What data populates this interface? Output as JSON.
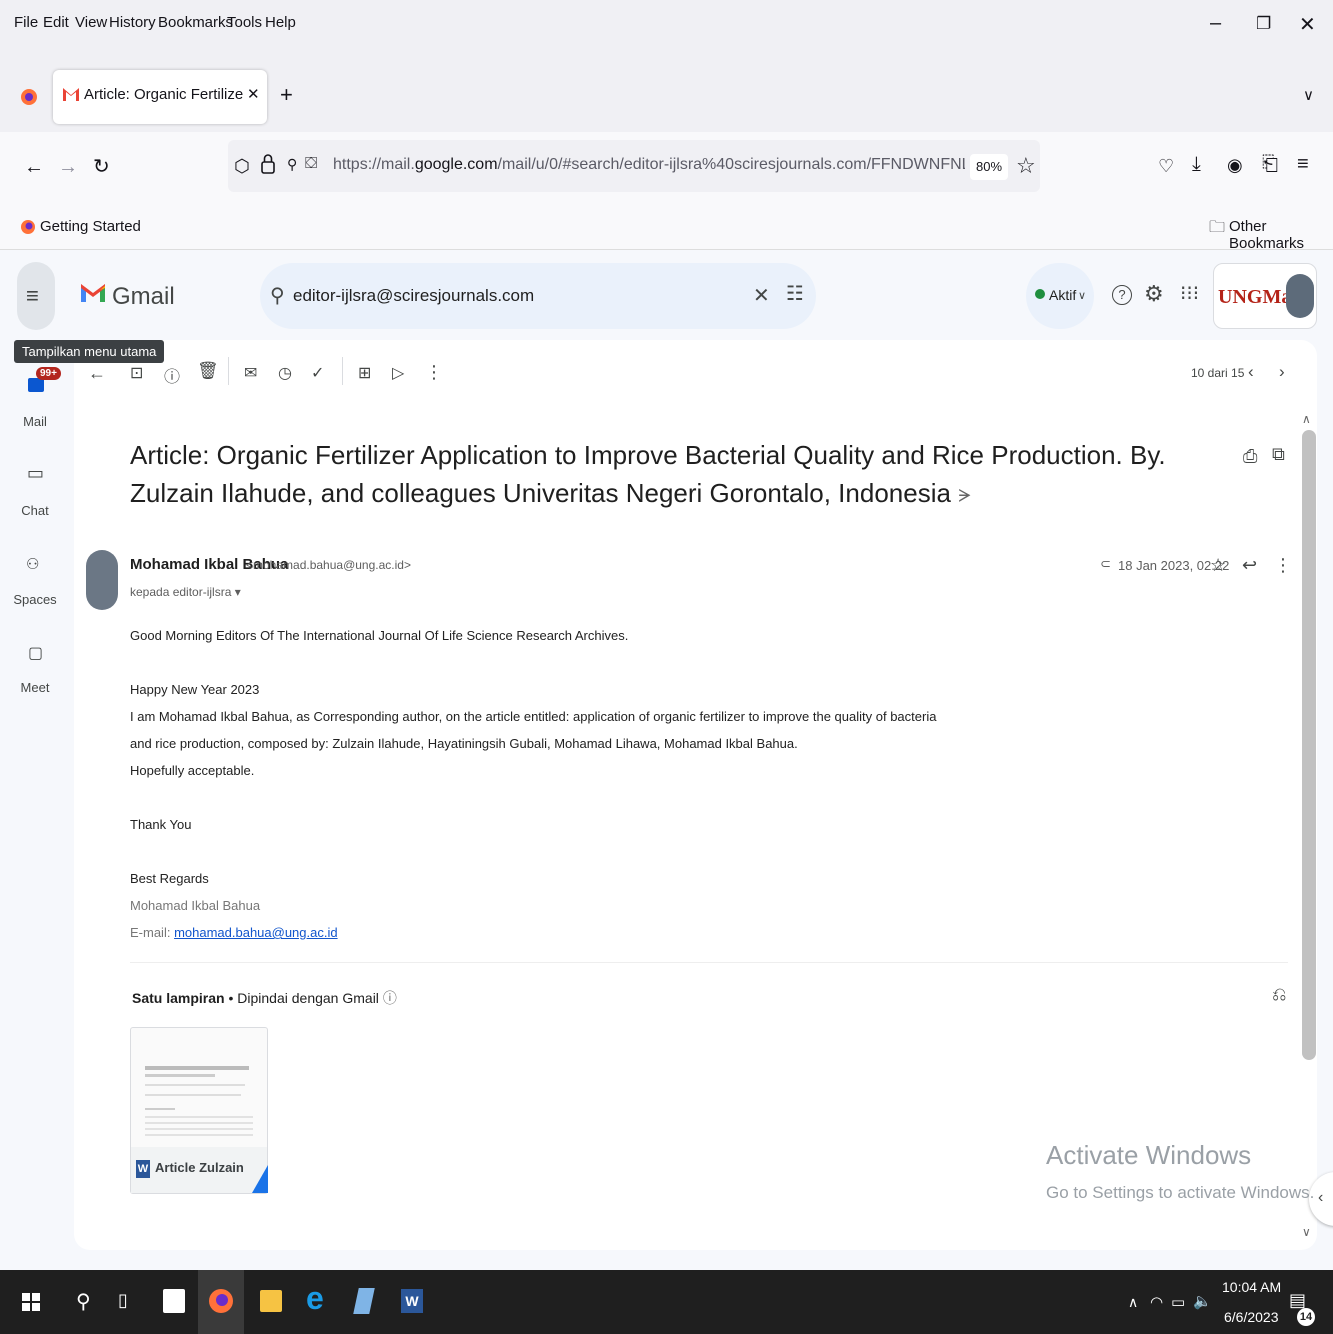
{
  "menubar": {
    "items": [
      "File",
      "Edit",
      "View",
      "History",
      "Bookmarks",
      "Tools",
      "Help"
    ]
  },
  "tab": {
    "title": "Article: Organic Fertilizer Applic"
  },
  "navbar": {
    "url_prefix": "https://mail.",
    "url_domain": "google.com",
    "url_rest": "/mail/u/0/#search/editor-ijlsra%40sciresjournals.com/FFNDWNFNLZlWpwGLSzJSMS",
    "zoom": "80%"
  },
  "bookmarks": {
    "getting_started": "Getting Started",
    "other": "Other Bookmarks"
  },
  "gmail": {
    "brand": "Gmail",
    "search_query": "editor-ijlsra@sciresjournals.com",
    "status": "Aktif",
    "tooltip": "Tampilkan menu utama",
    "badge": "99+",
    "pagination": "10 dari 15",
    "sidebar": [
      {
        "label": "Mail"
      },
      {
        "label": "Chat"
      },
      {
        "label": "Spaces"
      },
      {
        "label": "Meet"
      }
    ],
    "profile_badge": "UNGMail"
  },
  "email": {
    "subject": "Article: Organic Fertilizer Application to Improve Bacterial Quality and Rice Production. By. Zulzain Ilahude, and colleagues Univeritas Negeri Gorontalo, Indonesia",
    "sender_name": "Mohamad Ikbal Bahua",
    "sender_email": "<mohamad.bahua@ung.ac.id>",
    "recipient": "kepada editor-ijlsra",
    "date": "18 Jan 2023, 02.22",
    "body": {
      "greeting": "Good Morning Editors Of The International Journal Of Life Science Research Archives.",
      "line1": "Happy New Year 2023",
      "line2": "I am Mohamad Ikbal Bahua, as Corresponding author, on the article entitled: application of organic fertilizer to improve the quality of bacteria",
      "line3": "and rice production, composed by: Zulzain Ilahude, Hayatiningsih Gubali, Mohamad Lihawa, Mohamad Ikbal Bahua.",
      "line4": "Hopefully acceptable.",
      "thanks": "Thank You",
      "regards": "Best Regards",
      "sig_name": "Mohamad Ikbal Bahua",
      "sig_email_label": "E-mail: ",
      "sig_email": "mohamad.bahua@ung.ac.id"
    },
    "attachments": {
      "heading": "Satu lampiran",
      "scanned": " • Dipindai dengan Gmail",
      "file_name": "Article Zulzain ILa..."
    }
  },
  "watermark": {
    "line1": "Activate Windows",
    "line2": "Go to Settings to activate Windows."
  },
  "taskbar": {
    "time": "10:04 AM",
    "date": "6/6/2023",
    "notifications": "14"
  }
}
